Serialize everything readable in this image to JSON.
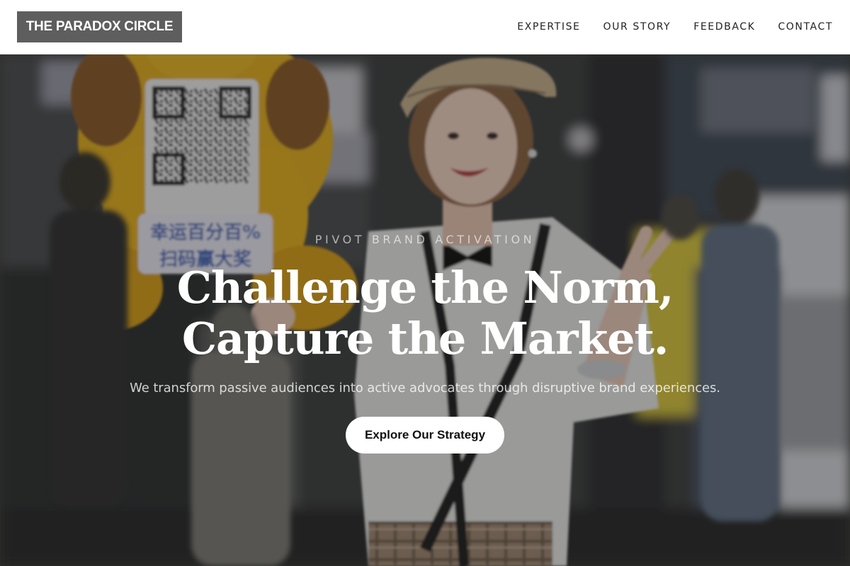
{
  "header": {
    "logo_text": "THE PARADOX CIRCLE",
    "nav": [
      {
        "label": "EXPERTISE"
      },
      {
        "label": "OUR STORY"
      },
      {
        "label": "FEEDBACK"
      },
      {
        "label": "CONTACT"
      }
    ]
  },
  "hero": {
    "eyebrow": "PIVOT BRAND ACTIVATION",
    "headline_line1": "Challenge the Norm,",
    "headline_line2": "Capture the Market.",
    "subtext": "We transform passive audiences into active advocates through disruptive brand experiences.",
    "cta_label": "Explore Our Strategy",
    "sign_text_line1": "幸运百分百%",
    "sign_text_line2": "扫码赢大奖"
  },
  "colors": {
    "header_bg": "#ffffff",
    "logo_bg": "#5e5e5e",
    "cta_bg": "#ffffff",
    "headline": "#ffffff",
    "mascot_yellow": "#e8b21e"
  }
}
